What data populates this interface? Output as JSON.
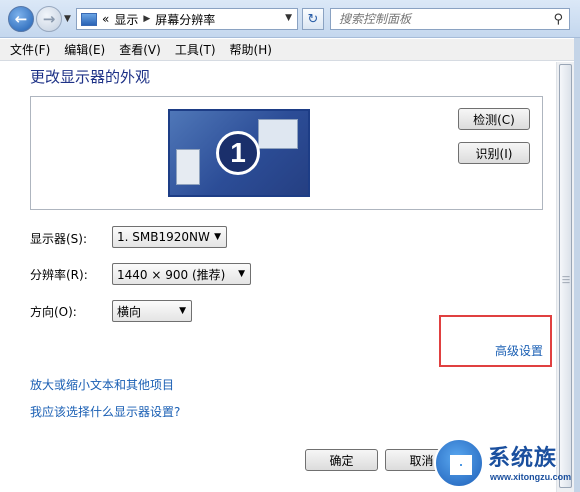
{
  "address_bar": {
    "crumbs": [
      "«",
      "显示",
      "屏幕分辨率"
    ],
    "search_placeholder": "搜索控制面板"
  },
  "menu": [
    "文件(F)",
    "编辑(E)",
    "查看(V)",
    "工具(T)",
    "帮助(H)"
  ],
  "main": {
    "title": "更改显示器的外观",
    "monitor_number": "1",
    "detect_label": "检测(C)",
    "identify_label": "识别(I)",
    "display_label": "显示器(S):",
    "display_value": "1. SMB1920NW",
    "resolution_label": "分辨率(R):",
    "resolution_value": "1440 × 900 (推荐)",
    "orientation_label": "方向(O):",
    "orientation_value": "横向",
    "advanced_link": "高级设置",
    "text_size_link": "放大或缩小文本和其他项目",
    "which_settings_link": "我应该选择什么显示器设置?",
    "ok_label": "确定",
    "cancel_label": "取消"
  },
  "watermark": {
    "name": "系统族",
    "url": "www.xitongzu.com"
  },
  "colors": {
    "title": "#1e3287",
    "link": "#1a5fb4",
    "highlight": "#e04040"
  }
}
